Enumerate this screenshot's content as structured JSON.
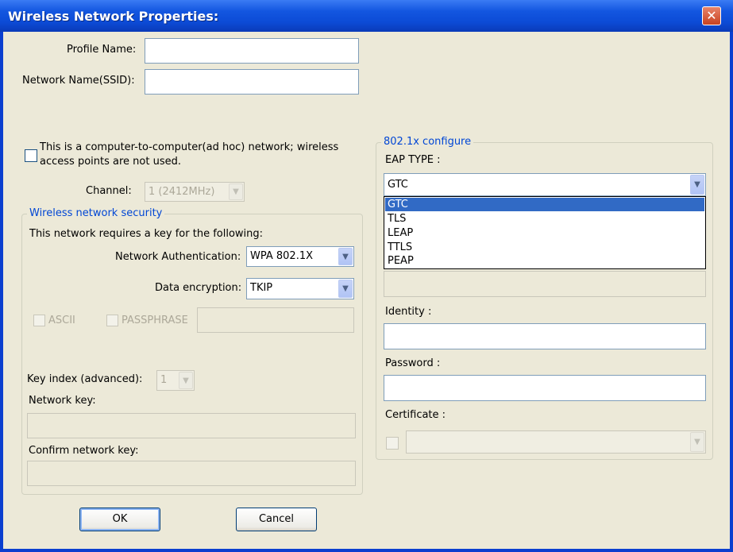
{
  "window": {
    "title": "Wireless Network Properties:"
  },
  "fields": {
    "profile_name": {
      "label": "Profile Name:",
      "value": ""
    },
    "ssid": {
      "label": "Network Name(SSID):",
      "value": ""
    }
  },
  "adhoc": {
    "label_line1": "This is a computer-to-computer(ad hoc) network; wireless",
    "label_line2": "access points are not used.",
    "checked": false
  },
  "channel": {
    "label": "Channel:",
    "value": "1  (2412MHz)"
  },
  "security": {
    "legend": "Wireless network security",
    "intro": "This network requires a key for the following:",
    "auth_label": "Network Authentication:",
    "auth_value": "WPA 802.1X",
    "enc_label": "Data encryption:",
    "enc_value": "TKIP",
    "ascii_label": "ASCII",
    "passphrase_label": "PASSPHRASE",
    "key_index_label": "Key index (advanced):",
    "key_index_value": "1",
    "network_key_label": "Network key:",
    "confirm_key_label": "Confirm network key:"
  },
  "dot1x": {
    "legend": "802.1x configure",
    "eap_type_label": "EAP TYPE :",
    "eap_type_value": "GTC",
    "eap_options": [
      "GTC",
      "TLS",
      "LEAP",
      "TTLS",
      "PEAP"
    ],
    "identity_label": "Identity :",
    "password_label": "Password :",
    "certificate_label": "Certificate :"
  },
  "buttons": {
    "ok": "OK",
    "cancel": "Cancel"
  },
  "colors": {
    "title_bar": "#0c4bd6",
    "dialog_bg": "#ece9d8",
    "group_legend": "#0046d5",
    "selection": "#316ac5"
  }
}
